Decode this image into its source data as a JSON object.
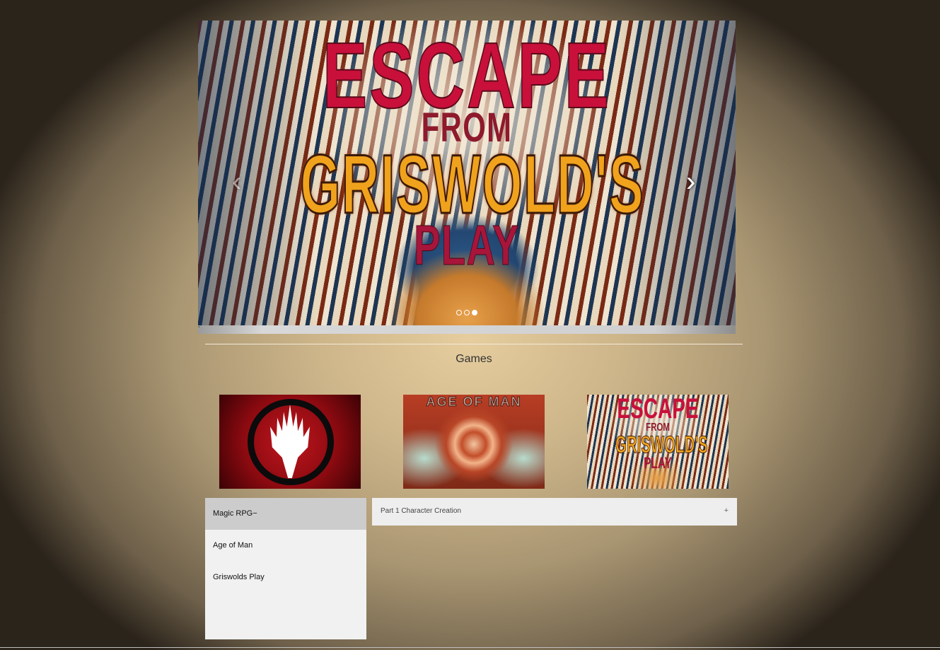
{
  "carousel": {
    "slide": {
      "title_line1": "ESCAPE",
      "title_line2": "FROM",
      "title_line3": "GRISWOLD'S",
      "title_line4": "PLAY"
    },
    "prev_icon": "chevron-left-icon",
    "next_icon": "chevron-right-icon",
    "prev_glyph": "‹",
    "next_glyph": "›",
    "slide_count": 3,
    "active_slide": 3,
    "caption_mark": "-"
  },
  "stray_mark": "-",
  "section": {
    "title": "Games"
  },
  "thumbnails": [
    {
      "name": "Magic RPG",
      "image": "planeswalker-logo"
    },
    {
      "name": "Age of Man",
      "image_text": "AGE OF MAN"
    },
    {
      "name": "Griswolds Play",
      "image_text": [
        "ESCAPE",
        "FROM",
        "GRISWOLD'S",
        "PLAY"
      ]
    }
  ],
  "game_list": {
    "items": [
      {
        "label": "Magic RPG−",
        "active": true
      },
      {
        "label": "Age of Man",
        "active": false
      },
      {
        "label": "Griswolds Play",
        "active": false
      }
    ]
  },
  "accordion": {
    "items": [
      {
        "label": "Part 1 Character Creation",
        "toggle": "+"
      }
    ]
  },
  "colors": {
    "poster_red": "#c8103b",
    "poster_orange": "#f0a21d",
    "active_tab": "#cccccc",
    "panel_bg": "#f1f1f1"
  }
}
